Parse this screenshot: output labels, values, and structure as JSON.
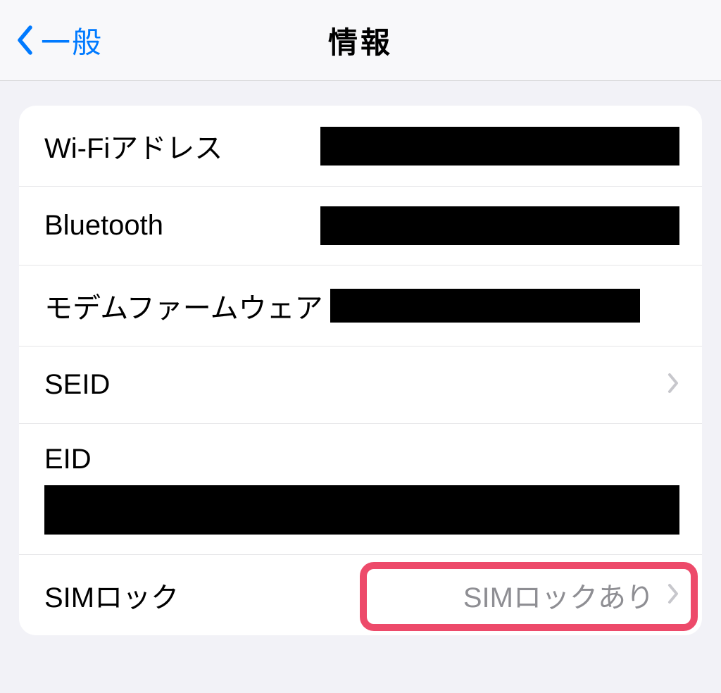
{
  "nav": {
    "back_label": "一般",
    "title": "情報"
  },
  "rows": {
    "wifi": {
      "label": "Wi-Fiアドレス"
    },
    "bluetooth": {
      "label": "Bluetooth"
    },
    "modem": {
      "label": "モデムファームウェア"
    },
    "seid": {
      "label": "SEID"
    },
    "eid": {
      "label": "EID"
    },
    "simlock": {
      "label": "SIMロック",
      "value": "SIMロックあり"
    }
  }
}
